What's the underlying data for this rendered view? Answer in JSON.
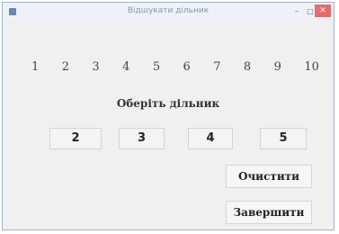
{
  "window": {
    "title": "Відшукати дільник",
    "controls": {
      "minimize": "–",
      "maximize": "□",
      "close": "✕"
    }
  },
  "numbers": [
    "1",
    "2",
    "3",
    "4",
    "5",
    "6",
    "7",
    "8",
    "9",
    "10"
  ],
  "prompt": "Оберіть дільник",
  "divisor_buttons": [
    "2",
    "3",
    "4",
    "5"
  ],
  "actions": {
    "clear": "Очистити",
    "finish": "Завершити"
  }
}
